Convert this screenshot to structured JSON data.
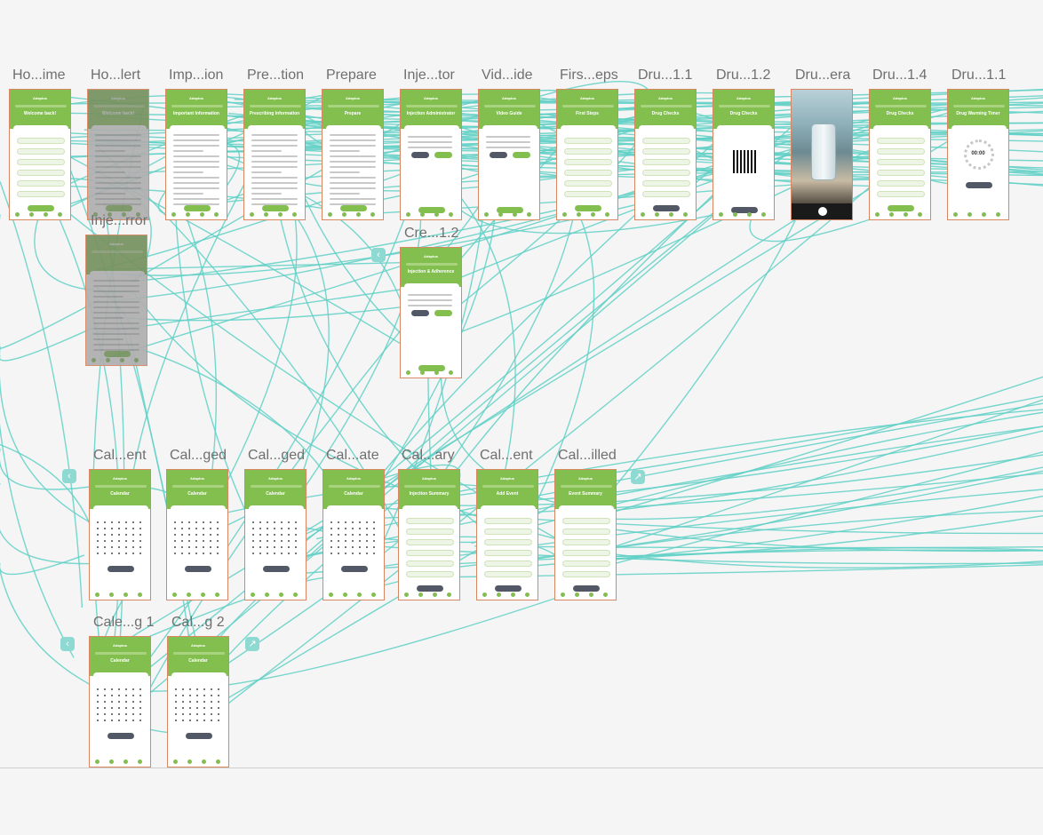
{
  "accent_color": "#83bf4f",
  "frame_border_color": "#d98763",
  "connector_color": "#5fd0c5",
  "frame_app_name": "Adaptus",
  "frames": [
    {
      "label": "Ho...ime",
      "title": "Welcome back!",
      "kind": "welcome"
    },
    {
      "label": "Ho...lert",
      "title": "Welcome back!",
      "kind": "alert"
    },
    {
      "label": "Imp...ion",
      "title": "Important Information",
      "kind": "text"
    },
    {
      "label": "Pre...tion",
      "title": "Prescribing Information",
      "kind": "text"
    },
    {
      "label": "Prepare",
      "title": "Prepare",
      "kind": "text"
    },
    {
      "label": "Inje...tor",
      "title": "Injection Administrator",
      "kind": "choice"
    },
    {
      "label": "Vid...ide",
      "title": "Video Guide",
      "kind": "video"
    },
    {
      "label": "Firs...eps",
      "title": "First Steps",
      "kind": "steps"
    },
    {
      "label": "Dru...1.1",
      "title": "Drug Checks",
      "kind": "form"
    },
    {
      "label": "Dru...1.2",
      "title": "Drug Checks",
      "kind": "qr"
    },
    {
      "label": "Dru...era",
      "title": "",
      "kind": "camera"
    },
    {
      "label": "Dru...1.4",
      "title": "Drug Checks",
      "kind": "checks"
    },
    {
      "label": "Dru...1.1",
      "title": "Drug Warming Timer",
      "kind": "timer"
    },
    {
      "label": "Inje...rror",
      "title": "",
      "kind": "error"
    },
    {
      "label": "Cre...1.2",
      "title": "Injection & Adherence",
      "kind": "choice2"
    },
    {
      "label": "Cal...ent",
      "title": "Calendar",
      "kind": "calendar"
    },
    {
      "label": "Cal...ged",
      "title": "Calendar",
      "kind": "calendar"
    },
    {
      "label": "Cal...ged",
      "title": "Calendar",
      "kind": "calendar"
    },
    {
      "label": "Cal...ate",
      "title": "Calendar",
      "kind": "calendar"
    },
    {
      "label": "Cal...ary",
      "title": "Injection Summary",
      "kind": "list"
    },
    {
      "label": "Cal...ent",
      "title": "Add Event",
      "kind": "form"
    },
    {
      "label": "Cal...illed",
      "title": "Event Summary",
      "kind": "form"
    },
    {
      "label": "Cale...g 1",
      "title": "Calendar",
      "kind": "calendar"
    },
    {
      "label": "Cal...g 2",
      "title": "Calendar",
      "kind": "calendar"
    }
  ],
  "timer": {
    "value": "00:00"
  },
  "nav_icons": [
    {
      "name": "back-icon",
      "glyph": "‹"
    },
    {
      "name": "back-icon",
      "glyph": "‹"
    },
    {
      "name": "back-icon",
      "glyph": "‹"
    },
    {
      "name": "external-link-icon",
      "glyph": "↗"
    },
    {
      "name": "external-link-icon",
      "glyph": "↗"
    }
  ]
}
